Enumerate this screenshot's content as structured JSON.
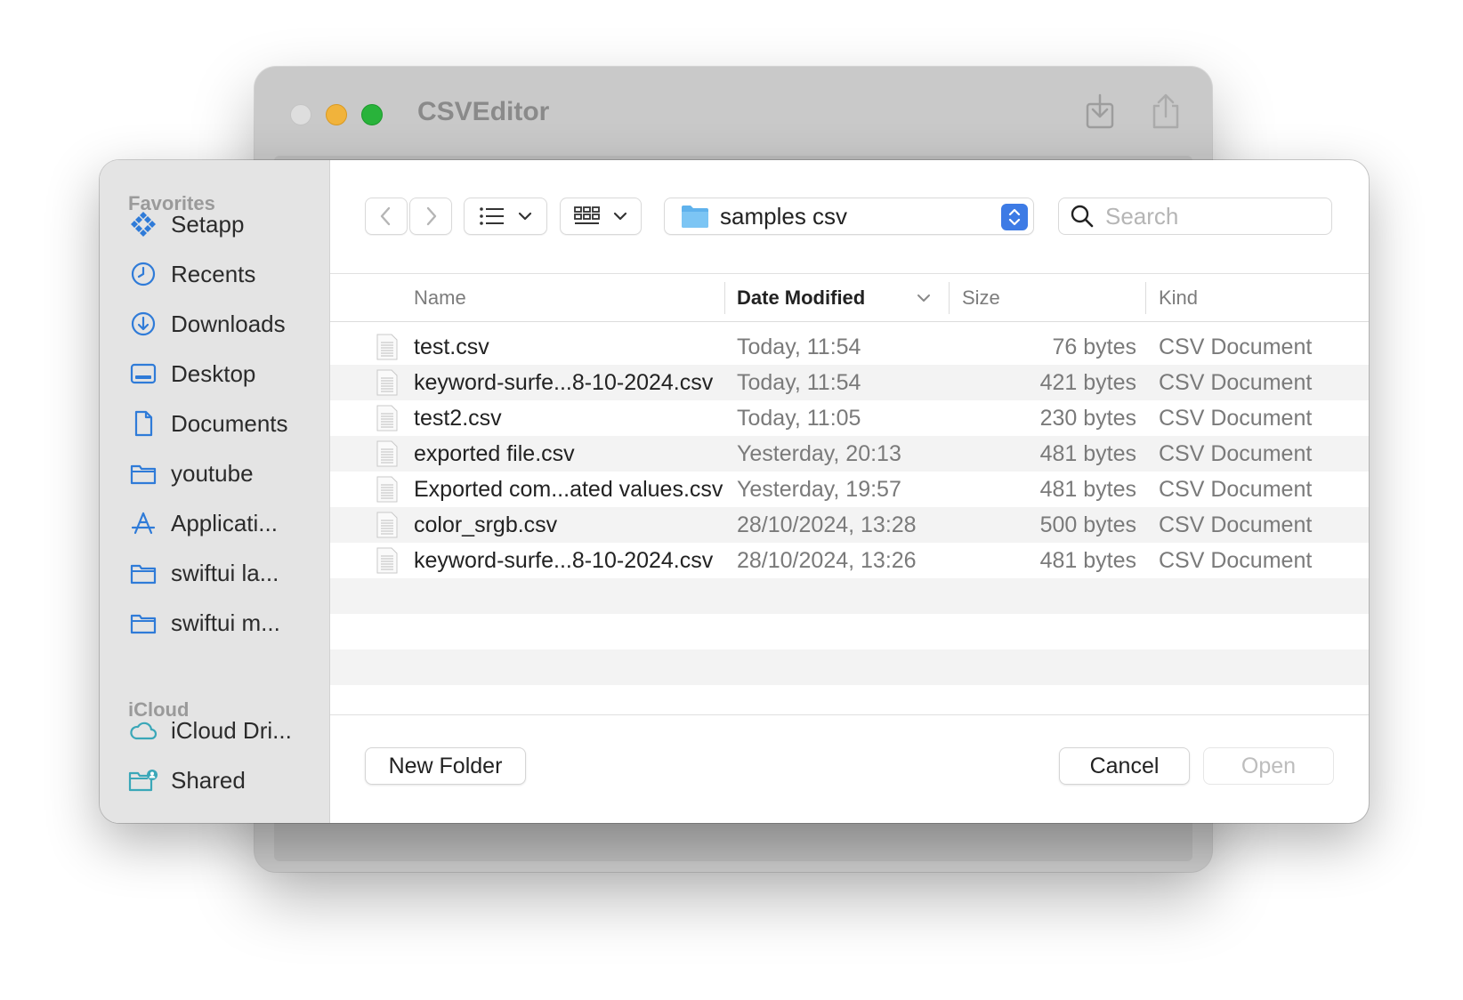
{
  "app": {
    "title": "CSVEditor",
    "toolbar_icons": [
      "download-icon",
      "share-icon"
    ]
  },
  "sidebar": {
    "favorites_label": "Favorites",
    "favorites": [
      {
        "label": "Setapp",
        "icon": "setapp-icon"
      },
      {
        "label": "Recents",
        "icon": "clock-icon"
      },
      {
        "label": "Downloads",
        "icon": "download-circle-icon"
      },
      {
        "label": "Desktop",
        "icon": "desktop-icon"
      },
      {
        "label": "Documents",
        "icon": "document-icon"
      },
      {
        "label": "youtube",
        "icon": "folder-icon"
      },
      {
        "label": "Applicati...",
        "icon": "applications-icon"
      },
      {
        "label": "swiftui la...",
        "icon": "folder-icon"
      },
      {
        "label": "swiftui m...",
        "icon": "folder-icon"
      }
    ],
    "icloud_label": "iCloud",
    "icloud": [
      {
        "label": "iCloud Dri...",
        "icon": "cloud-icon"
      },
      {
        "label": "Shared",
        "icon": "shared-folder-icon"
      }
    ]
  },
  "toolbar": {
    "path_label": "samples csv",
    "search_placeholder": "Search"
  },
  "columns": {
    "name": "Name",
    "date": "Date Modified",
    "size": "Size",
    "kind": "Kind",
    "sorted_by": "Date Modified"
  },
  "files": [
    {
      "name": "test.csv",
      "date": "Today, 11:54",
      "size": "76 bytes",
      "kind": "CSV Document"
    },
    {
      "name": "keyword-surfe...8-10-2024.csv",
      "date": "Today, 11:54",
      "size": "421 bytes",
      "kind": "CSV Document"
    },
    {
      "name": "test2.csv",
      "date": "Today, 11:05",
      "size": "230 bytes",
      "kind": "CSV Document"
    },
    {
      "name": "exported file.csv",
      "date": "Yesterday, 20:13",
      "size": "481 bytes",
      "kind": "CSV Document"
    },
    {
      "name": "Exported com...ated values.csv",
      "date": "Yesterday, 19:57",
      "size": "481 bytes",
      "kind": "CSV Document"
    },
    {
      "name": "color_srgb.csv",
      "date": "28/10/2024, 13:28",
      "size": "500 bytes",
      "kind": "CSV Document"
    },
    {
      "name": "keyword-surfe...8-10-2024.csv",
      "date": "28/10/2024, 13:26",
      "size": "481 bytes",
      "kind": "CSV Document"
    }
  ],
  "footer": {
    "new_folder": "New Folder",
    "cancel": "Cancel",
    "open": "Open"
  },
  "colors": {
    "accent": "#3d7be5",
    "sidebar_icon": "#2f7bd8",
    "icloud_icon": "#3aa7b8"
  }
}
